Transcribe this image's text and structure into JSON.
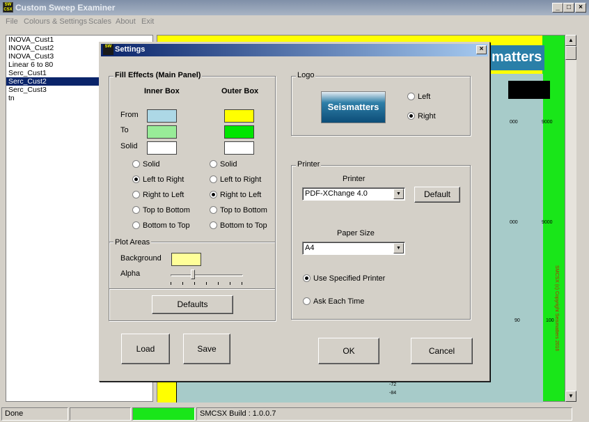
{
  "window": {
    "title": "Custom Sweep Examiner",
    "app_icon_text": "SW CSX",
    "min": "_",
    "max": "□",
    "close": "×"
  },
  "menu": [
    "File",
    "Colours & Settings",
    "Scales",
    "About",
    "Exit"
  ],
  "sweep_list": [
    "INOVA_Cust1",
    "INOVA_Cust2",
    "INOVA_Cust3",
    "Linear 6 to 80",
    "Serc_Cust1",
    "Serc_Cust2",
    "Serc_Cust3",
    "tn"
  ],
  "selected_sweep_index": 5,
  "background_plot": {
    "logo_text": "matters",
    "tick_labels_a": [
      "000",
      "9000"
    ],
    "tick_labels_b": [
      "000",
      "9000"
    ],
    "tick_labels_c": [
      "90",
      "100"
    ],
    "y_labels": [
      "-72",
      "-84"
    ],
    "copyright": "SMCSX (c) Copyright Seismatters 2016"
  },
  "status": {
    "left": "Done",
    "build": "SMCSX Build : 1.0.0.7"
  },
  "dialog": {
    "title": "Settings",
    "close": "×",
    "fill_effects": {
      "label": "Fill Effects (Main Panel)",
      "inner_box": "Inner Box",
      "outer_box": "Outer Box",
      "rows": [
        "From",
        "To",
        "Solid"
      ],
      "inner_colors": {
        "from": "#add8e6",
        "to": "#98ec98",
        "solid": "#ffffff"
      },
      "outer_colors": {
        "from": "#ffff00",
        "to": "#00e600",
        "solid": "#ffffff"
      },
      "options": [
        "Solid",
        "Left to Right",
        "Right to Left",
        "Top to Bottom",
        "Bottom to Top"
      ],
      "inner_selected": "Left to Right",
      "outer_selected": "Right to Left"
    },
    "plot_areas": {
      "label": "Plot Areas",
      "background_label": "Background",
      "background_color": "#ffff99",
      "alpha_label": "Alpha",
      "alpha_level": 0.3
    },
    "defaults_button": "Defaults",
    "logo": {
      "label": "Logo",
      "logo_text": "Seismatters",
      "options": [
        "Left",
        "Right"
      ],
      "selected": "Right"
    },
    "printer": {
      "label": "Printer",
      "printer_label": "Printer",
      "printer_value": "PDF-XChange 4.0",
      "default_button": "Default",
      "paper_label": "Paper Size",
      "paper_value": "A4",
      "options": [
        "Use Specified Printer",
        "Ask Each Time"
      ],
      "selected": "Use Specified Printer"
    },
    "load_button": "Load",
    "save_button": "Save",
    "ok_button": "OK",
    "cancel_button": "Cancel"
  }
}
